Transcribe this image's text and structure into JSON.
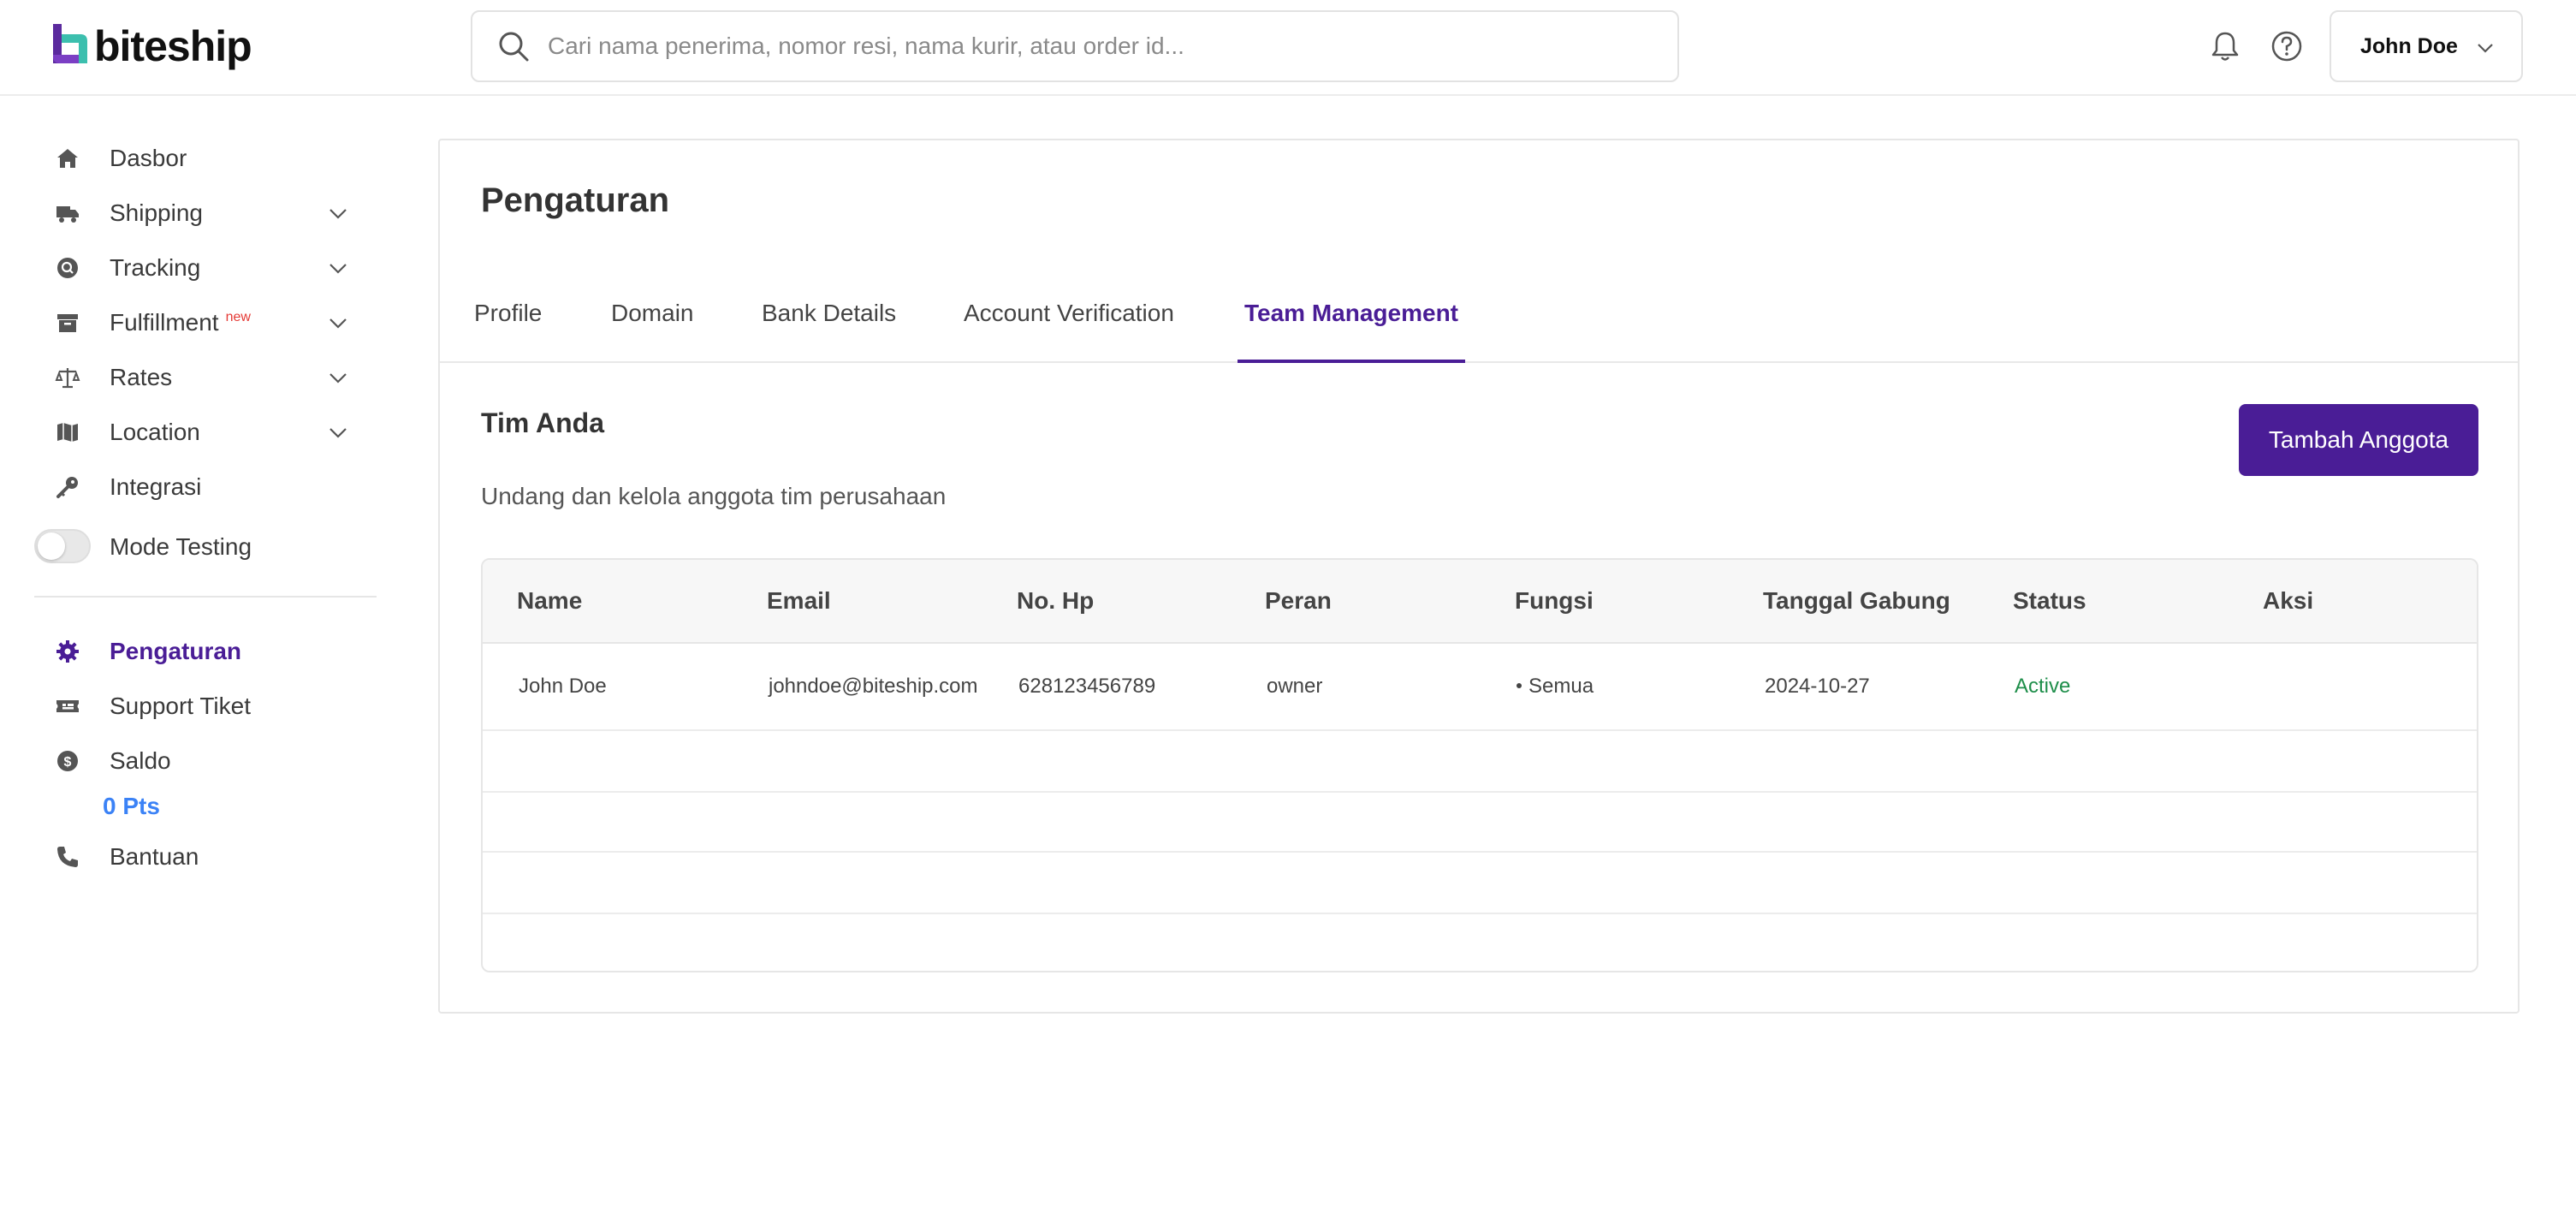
{
  "brand": {
    "name": "biteship"
  },
  "search": {
    "placeholder": "Cari nama penerima, nomor resi, nama kurir, atau order id..."
  },
  "user": {
    "name": "John Doe"
  },
  "sidebar": {
    "items": [
      {
        "label": "Dasbor",
        "icon": "home-icon"
      },
      {
        "label": "Shipping",
        "icon": "truck-icon"
      },
      {
        "label": "Tracking",
        "icon": "tracking-icon"
      },
      {
        "label": "Fulfillment",
        "badge": "new",
        "icon": "archive-icon"
      },
      {
        "label": "Rates",
        "icon": "scale-icon"
      },
      {
        "label": "Location",
        "icon": "map-icon"
      },
      {
        "label": "Integrasi",
        "icon": "key-icon"
      }
    ],
    "mode_testing": "Mode Testing",
    "bottom_items": [
      {
        "label": "Pengaturan",
        "icon": "gear-icon"
      },
      {
        "label": "Support Tiket",
        "icon": "ticket-icon"
      },
      {
        "label": "Saldo",
        "icon": "dollar-icon"
      },
      {
        "label": "Bantuan",
        "icon": "phone-icon"
      }
    ],
    "points": "0 Pts"
  },
  "main": {
    "title": "Pengaturan",
    "tabs": [
      {
        "label": "Profile"
      },
      {
        "label": "Domain"
      },
      {
        "label": "Bank Details"
      },
      {
        "label": "Account Verification"
      },
      {
        "label": "Team Management"
      }
    ],
    "active_tab": "Team Management",
    "section_title": "Tim Anda",
    "section_subtitle": "Undang dan kelola anggota tim perusahaan",
    "add_button": "Tambah Anggota"
  },
  "table": {
    "headers": [
      "Name",
      "Email",
      "No. Hp",
      "Peran",
      "Fungsi",
      "Tanggal Gabung",
      "Status",
      "Aksi"
    ],
    "rows": [
      {
        "name": "John Doe",
        "email": "johndoe@biteship.com",
        "phone": "628123456789",
        "role": "owner",
        "function": "Semua",
        "joined": "2024-10-27",
        "status": "Active",
        "action": ""
      }
    ]
  },
  "colors": {
    "accent": "#4a1d96",
    "points": "#3b82f6",
    "status_active": "#1e8e4a",
    "logo_teal": "#3cbfae",
    "logo_purple": "#5b2a9e"
  }
}
